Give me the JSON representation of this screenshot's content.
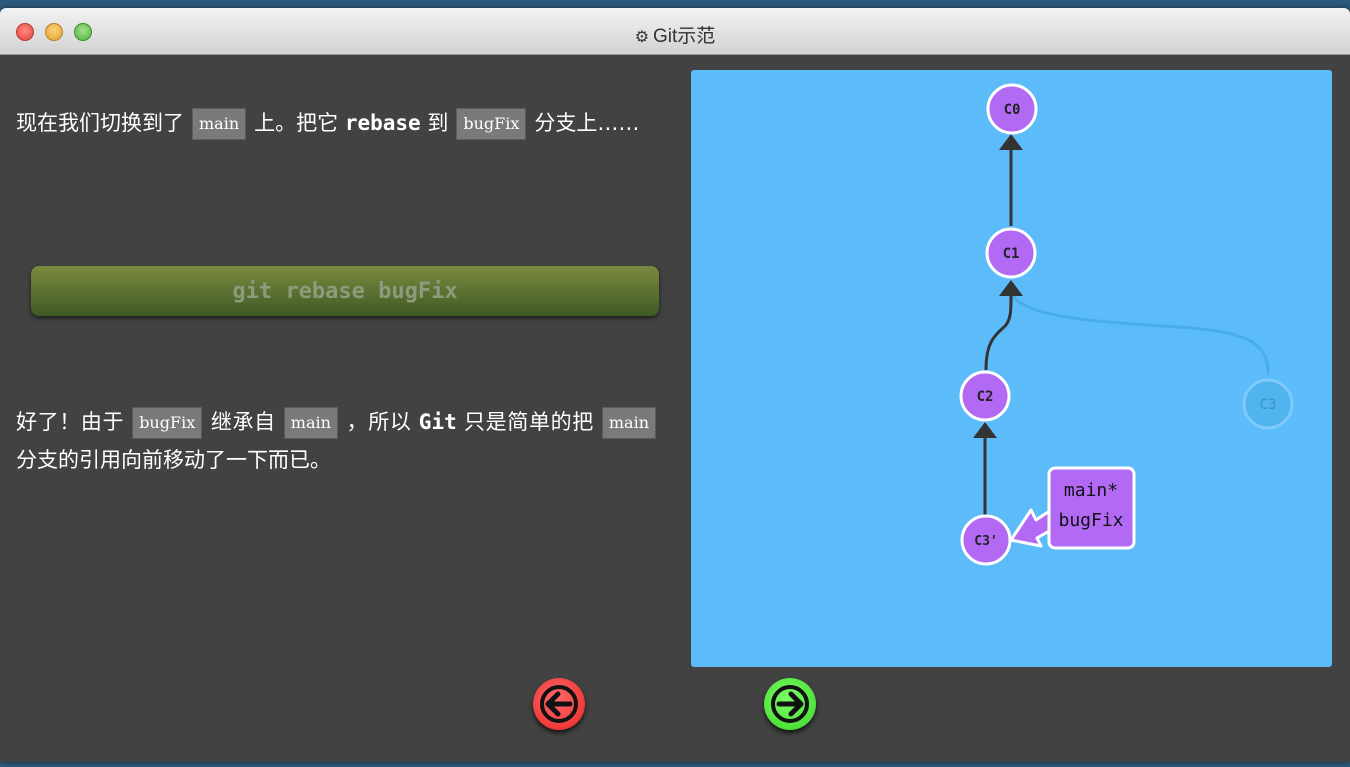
{
  "window": {
    "title": "Git示范",
    "title_icon": "gear-icon"
  },
  "dialog": {
    "para1": {
      "before_main": "现在我们切换到了",
      "main_tag": "main",
      "mid1": "上。把它",
      "rebase_word": "rebase",
      "mid2": "到",
      "bugfix_tag": "bugFix",
      "after": "分支上……"
    },
    "command": "git rebase bugFix",
    "para2": {
      "start": "好了！由于",
      "bugfix_tag": "bugFix",
      "mid1": "继承自",
      "main_tag": "main",
      "mid2": "，所以",
      "git_word": "Git",
      "mid3": "只是简单的把",
      "main_tag2": "main",
      "end": "分支的引用向前移动了一下而已。"
    }
  },
  "graph": {
    "commits": [
      {
        "id": "C0",
        "label": "C0"
      },
      {
        "id": "C1",
        "label": "C1"
      },
      {
        "id": "C2",
        "label": "C2"
      },
      {
        "id": "C3prime",
        "label": "C3'"
      },
      {
        "id": "C3",
        "label": "C3",
        "faded": true
      }
    ],
    "branch_label": {
      "line1": "main*",
      "line2": "bugFix"
    },
    "colors": {
      "background": "#5cbcfa",
      "commit_fill": "#b26af5",
      "commit_stroke": "#ffffff",
      "edge": "#333333",
      "faded": "#4aaee6"
    }
  },
  "nav": {
    "back_icon": "arrow-left-icon",
    "forward_icon": "arrow-right-icon"
  }
}
